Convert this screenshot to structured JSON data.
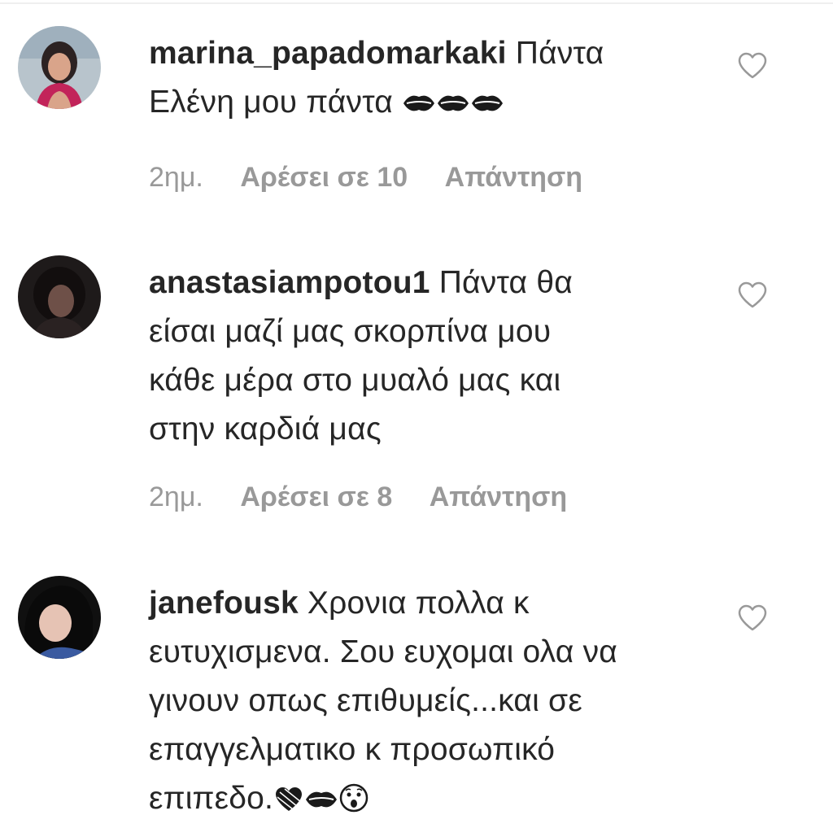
{
  "comments": [
    {
      "username": "marina_papadomarkaki",
      "text_lines": [
        "Πάντα",
        "Ελένη μου πάντα"
      ],
      "emoji": "kiss-mark-x3",
      "time": "2ημ.",
      "likes": "Αρέσει σε 10",
      "reply": "Απάντηση"
    },
    {
      "username": "anastasiampotou1",
      "text_lines": [
        "Πάντα θα",
        "είσαι μαζί μας σκορπίνα μου",
        "κάθε μέρα στο μυαλό μας και",
        "στην καρδιά μας"
      ],
      "time": "2ημ.",
      "likes": "Αρέσει σε 8",
      "reply": "Απάντηση"
    },
    {
      "username": "janefousk",
      "text_lines": [
        "Χρονια πολλα κ",
        "ευτυχισμενα. Σου ευχομαι ολα να",
        "γινουν οπως επιθυμείς...και σε",
        "επαγγελματικο κ προσωπικό",
        "επιπεδο."
      ],
      "emoji": "black-heart kiss-mark astonished-face"
    }
  ],
  "colors": {
    "text": "#262626",
    "meta": "#999999",
    "heart_outline": "#999999"
  },
  "icons": [
    "heart-outline-icon",
    "kiss-mark-emoji",
    "black-heart-emoji",
    "astonished-face-emoji"
  ]
}
